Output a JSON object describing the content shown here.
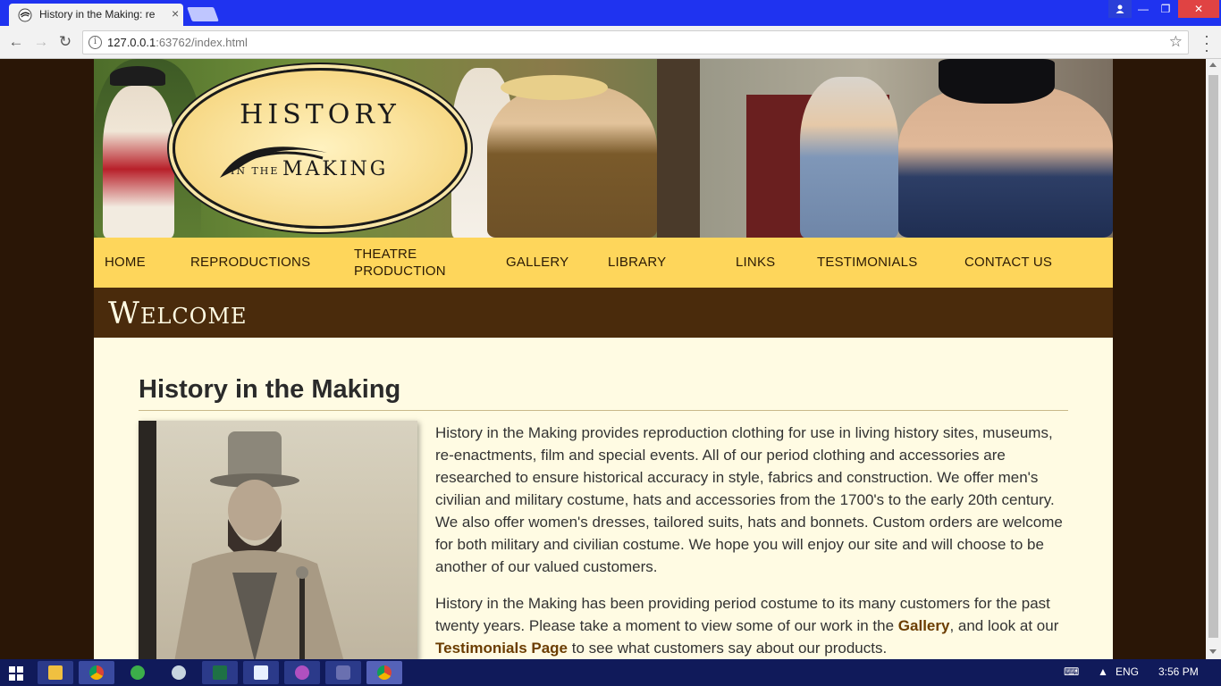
{
  "browser": {
    "tab_title": "History in the Making: re",
    "tab_close": "×",
    "url_host": "127.0.0.1",
    "url_rest": ":63762/index.html",
    "win_min": "—",
    "win_max": "❐",
    "win_close": "✕"
  },
  "site": {
    "logo_title": "HISTORY",
    "logo_inthe": "IN THE",
    "logo_making": "MAKING",
    "nav": [
      {
        "label": "HOME"
      },
      {
        "label": "REPRODUCTIONS"
      },
      {
        "label": "THEATRE\nPRODUCTION"
      },
      {
        "label": "GALLERY"
      },
      {
        "label": "LIBRARY"
      },
      {
        "label": "LINKS"
      },
      {
        "label": "TESTIMONIALS"
      },
      {
        "label": "CONTACT US"
      }
    ],
    "welcome": "Welcome",
    "heading": "History in the Making",
    "para1": "History in the Making provides reproduction clothing for use in living history sites, museums, re-enactments, film and special events. All of our period clothing and accessories are researched to ensure historical accuracy in style, fabrics and construction. We offer men's civilian and military costume, hats and accessories from the 1700's to the early 20th century. We also offer women's dresses, tailored suits, hats and bonnets. Custom orders are welcome for both military and civilian costume. We hope you will enjoy our site and will choose to be another of our valued customers.",
    "para2_a": "History in the Making has been providing period costume to its many customers for the past twenty years. Please take a moment to view some of our work in the ",
    "para2_link1": "Gallery",
    "para2_b": ", and look at our ",
    "para2_link2": "Testimonials Page",
    "para2_c": " to see what customers say about our products."
  },
  "taskbar": {
    "lang": "ENG",
    "time": "3:56 PM"
  },
  "colors": {
    "nav_bg": "#fed65b",
    "welcome_bg": "#4a2b0c",
    "content_bg": "#fffbe3",
    "page_bg": "#2a1606",
    "link": "#6b3d00"
  }
}
